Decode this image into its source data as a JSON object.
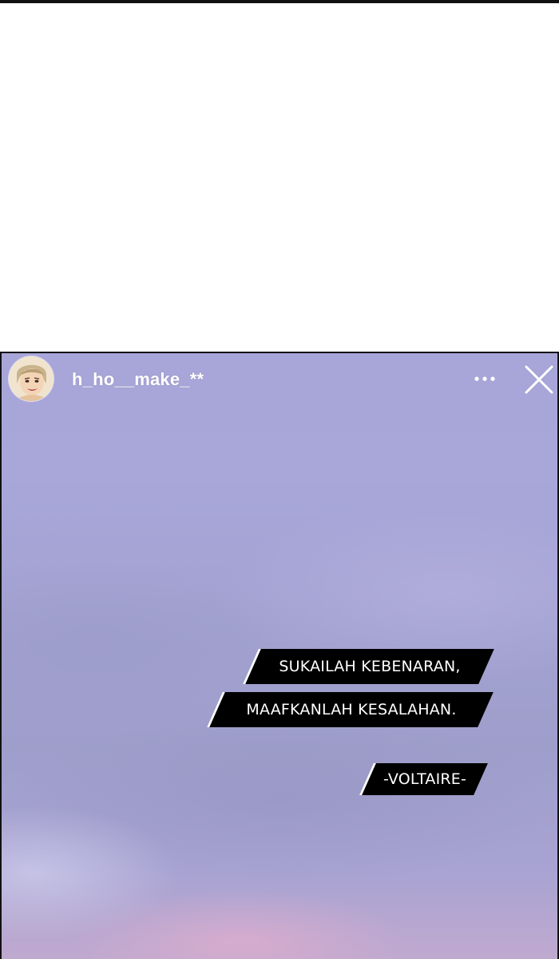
{
  "story": {
    "username": "h_ho__make_**",
    "header_icons": [
      "more-icon",
      "close-icon"
    ],
    "quote": {
      "line1": "SUKAILAH KEBENARAN,",
      "line2": "MAAFKANLAH KESALAHAN.",
      "author": "-VOLTAIRE-"
    }
  },
  "colors": {
    "sky_top": "#a8a6d8",
    "sky_bottom_pink": "#ebafcd",
    "caption_bg": "#000000",
    "caption_text": "#ffffff",
    "ui_icon": "#ffffff",
    "panel_border": "#111111"
  }
}
